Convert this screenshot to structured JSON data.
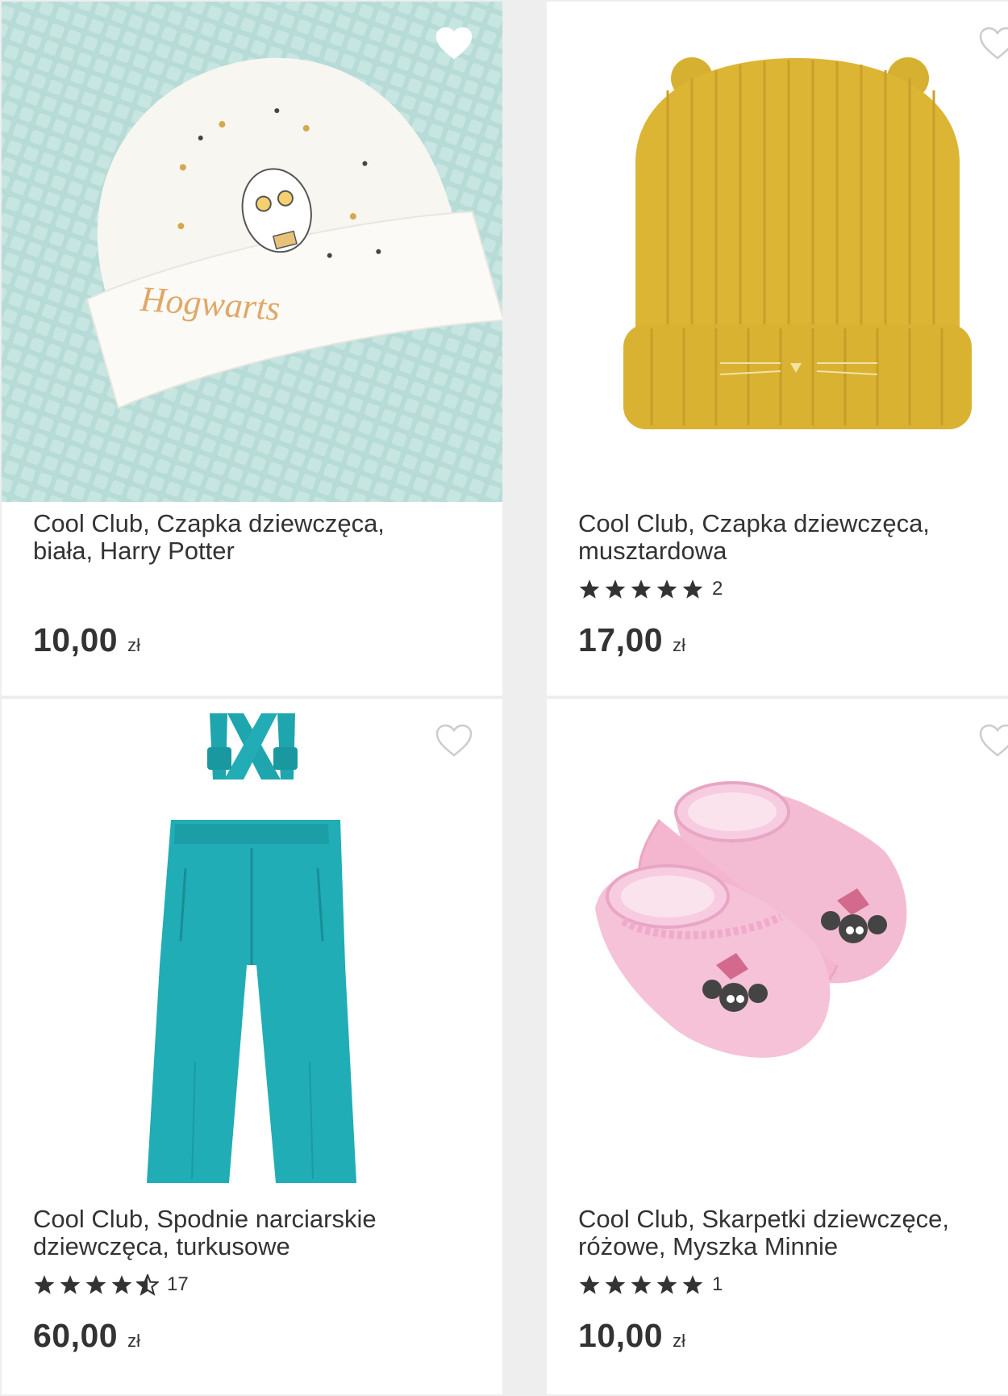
{
  "products": [
    {
      "title_line1": "Cool Club, Czapka dziewczęca,",
      "title_line2": "biała, Harry Potter",
      "rating_count": "",
      "price": "10,00",
      "currency": "zł",
      "favorite": true,
      "image_text": "Hogwarts"
    },
    {
      "title_line1": "Cool Club, Czapka dziewczęca,",
      "title_line2": "musztardowa",
      "rating_count": "2",
      "price": "17,00",
      "currency": "zł",
      "favorite": false
    },
    {
      "title_line1": "Cool Club, Spodnie narciarskie",
      "title_line2": "dziewczęca, turkusowe",
      "rating_count": "17",
      "price": "60,00",
      "currency": "zł",
      "favorite": false
    },
    {
      "title_line1": "Cool Club, Skarpetki dziewczęce,",
      "title_line2": "różowe, Myszka Minnie",
      "rating_count": "1",
      "price": "10,00",
      "currency": "zł",
      "favorite": false
    }
  ],
  "colors": {
    "page_bg": "#eeeeee",
    "card_bg": "#ffffff",
    "text": "#333333",
    "star": "#333333",
    "heart_outline": "#cccccc",
    "heart_filled": "#ffffff"
  },
  "icons": {
    "favorite": "heart-icon",
    "rating": "star-icon"
  }
}
